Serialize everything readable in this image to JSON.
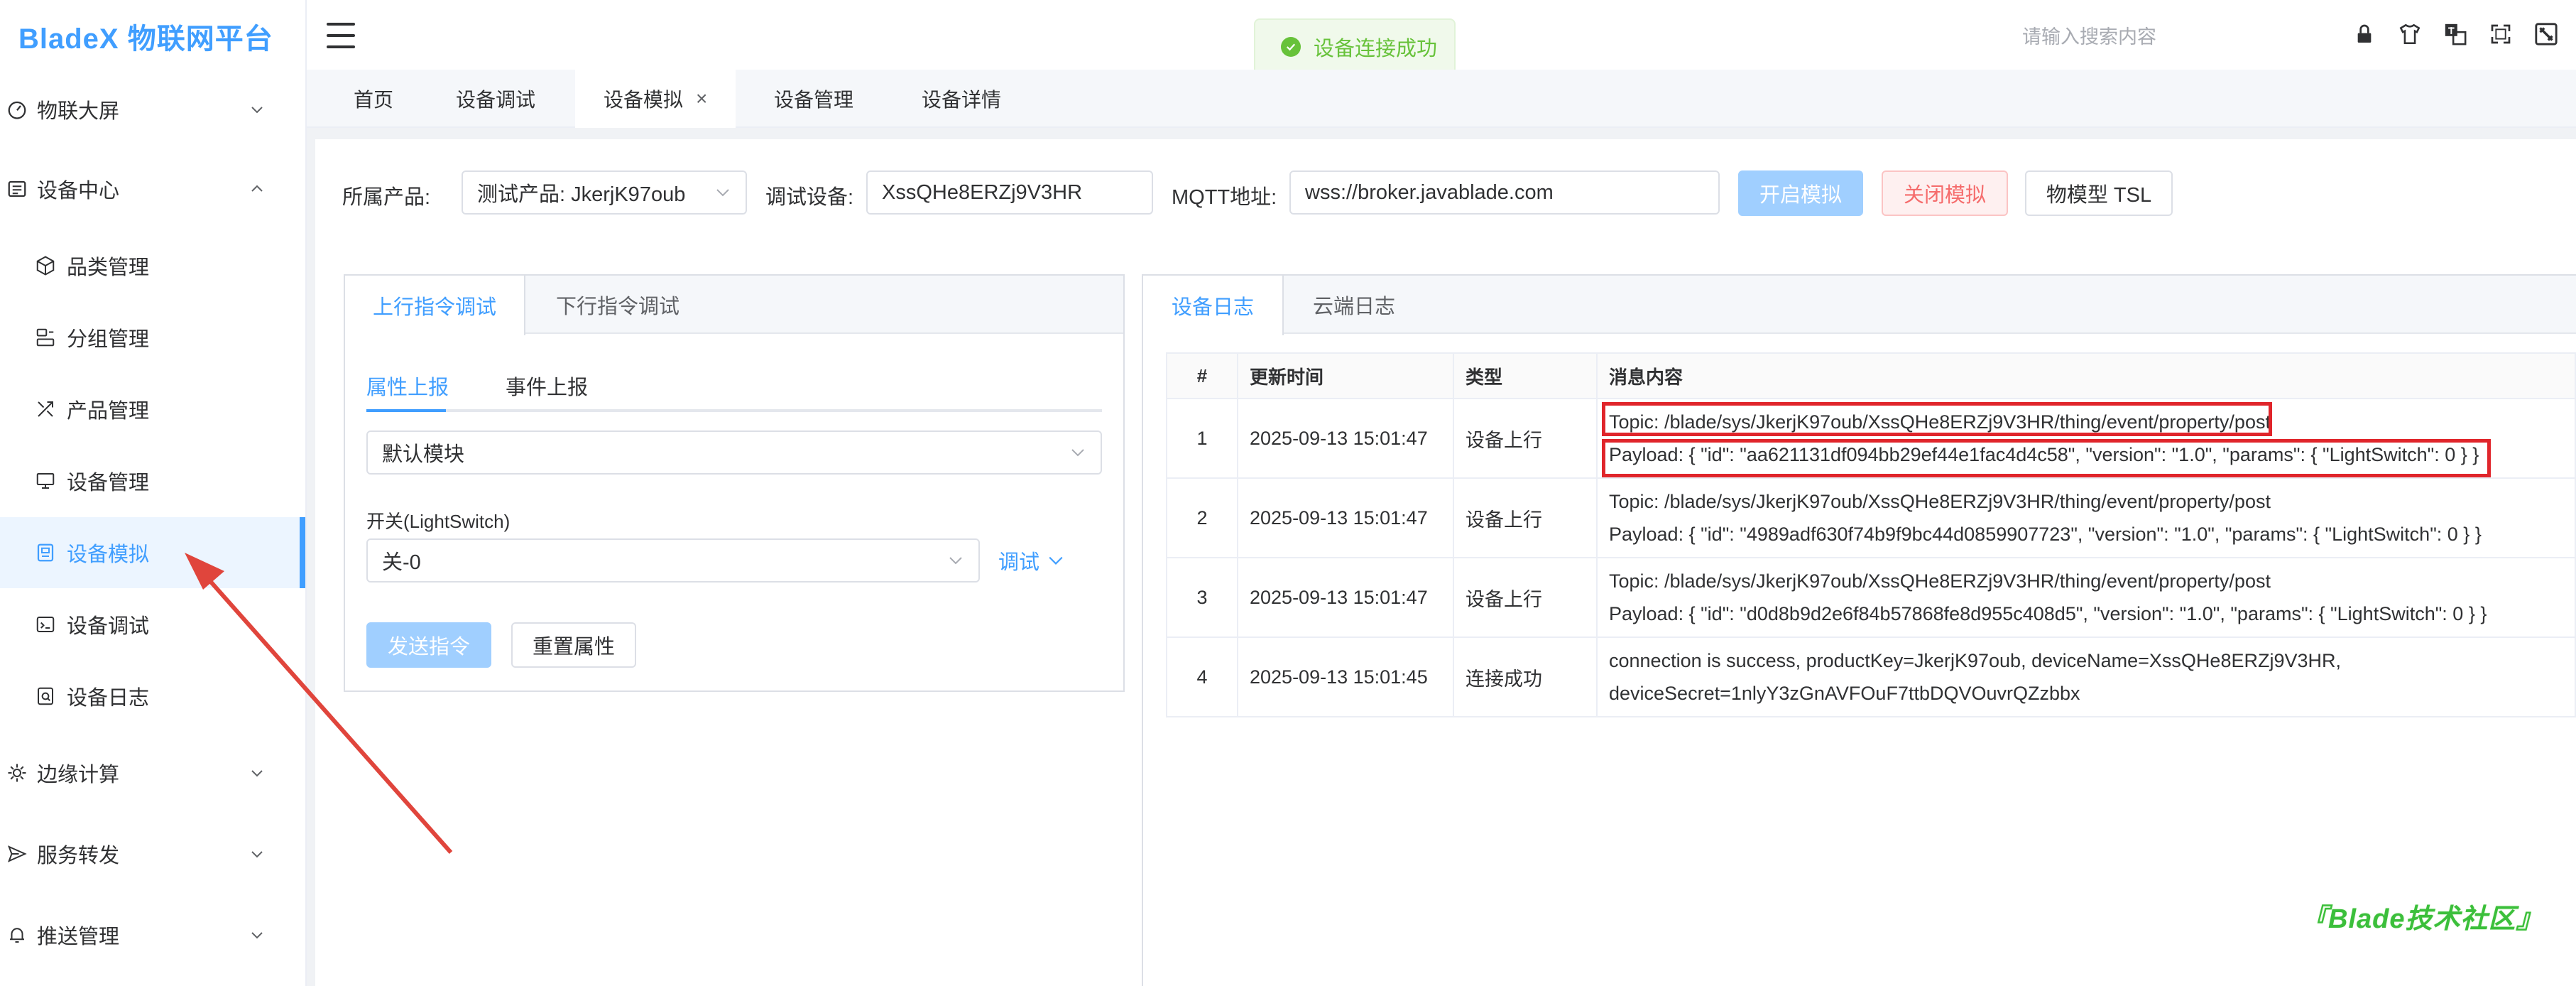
{
  "app": {
    "logo": "BladeX 物联网平台"
  },
  "topbar": {
    "search_placeholder": "请输入搜索内容",
    "toast": "设备连接成功"
  },
  "sidebar": {
    "items": [
      {
        "label": "物联大屏",
        "icon": "dashboard-icon"
      },
      {
        "label": "设备中心",
        "icon": "device-center-icon"
      },
      {
        "label": "品类管理",
        "icon": "cube-icon"
      },
      {
        "label": "分组管理",
        "icon": "group-icon"
      },
      {
        "label": "产品管理",
        "icon": "product-icon"
      },
      {
        "label": "设备管理",
        "icon": "monitor-icon"
      },
      {
        "label": "设备模拟",
        "icon": "simulate-icon"
      },
      {
        "label": "设备调试",
        "icon": "debug-icon"
      },
      {
        "label": "设备日志",
        "icon": "log-icon"
      },
      {
        "label": "边缘计算",
        "icon": "edge-icon"
      },
      {
        "label": "服务转发",
        "icon": "forward-icon"
      },
      {
        "label": "推送管理",
        "icon": "bell-icon"
      }
    ]
  },
  "tabs": [
    {
      "label": "首页"
    },
    {
      "label": "设备调试"
    },
    {
      "label": "设备模拟"
    },
    {
      "label": "设备管理"
    },
    {
      "label": "设备详情"
    }
  ],
  "form": {
    "product_label": "所属产品:",
    "product_value": "测试产品: JkerjK97oub",
    "device_label": "调试设备:",
    "device_value": "XssQHe8ERZj9V3HR",
    "mqtt_label": "MQTT地址:",
    "mqtt_value": "wss://broker.javablade.com",
    "btn_start": "开启模拟",
    "btn_stop": "关闭模拟",
    "btn_tsl": "物模型 TSL"
  },
  "left_panel": {
    "tabs": [
      "上行指令调试",
      "下行指令调试"
    ],
    "subtabs": [
      "属性上报",
      "事件上报"
    ],
    "module_select": "默认模块",
    "switch_label": "开关(LightSwitch)",
    "switch_value": "关-0",
    "debug_link": "调试",
    "btn_send": "发送指令",
    "btn_reset": "重置属性"
  },
  "right_panel": {
    "tabs": [
      "设备日志",
      "云端日志"
    ],
    "columns": [
      "#",
      "更新时间",
      "类型",
      "消息内容"
    ],
    "rows": [
      {
        "idx": "1",
        "time": "2025-09-13 15:01:47",
        "type": "设备上行",
        "line1": "Topic: /blade/sys/JkerjK97oub/XssQHe8ERZj9V3HR/thing/event/property/post",
        "line2": "Payload: { \"id\": \"aa621131df094bb29ef44e1fac4d4c58\", \"version\": \"1.0\", \"params\": { \"LightSwitch\": 0 } }"
      },
      {
        "idx": "2",
        "time": "2025-09-13 15:01:47",
        "type": "设备上行",
        "line1": "Topic: /blade/sys/JkerjK97oub/XssQHe8ERZj9V3HR/thing/event/property/post",
        "line2": "Payload: { \"id\": \"4989adf630f74b9f9bc44d0859907723\", \"version\": \"1.0\", \"params\": { \"LightSwitch\": 0 } }"
      },
      {
        "idx": "3",
        "time": "2025-09-13 15:01:47",
        "type": "设备上行",
        "line1": "Topic: /blade/sys/JkerjK97oub/XssQHe8ERZj9V3HR/thing/event/property/post",
        "line2": "Payload: { \"id\": \"d0d8b9d2e6f84b57868fe8d955c408d5\", \"version\": \"1.0\", \"params\": { \"LightSwitch\": 0 } }"
      },
      {
        "idx": "4",
        "time": "2025-09-13 15:01:45",
        "type": "连接成功",
        "line1": "connection is success, productKey=JkerjK97oub, deviceName=XssQHe8ERZj9V3HR,",
        "line2": "deviceSecret=1nlyY3zGnAVFOuF7ttbDQVOuvrQZzbbx"
      }
    ]
  },
  "watermark": "『Blade技术社区』",
  "colors": {
    "primary": "#409eff",
    "danger": "#f56c6c",
    "success": "#67c23a",
    "annotation": "#e0252b"
  }
}
